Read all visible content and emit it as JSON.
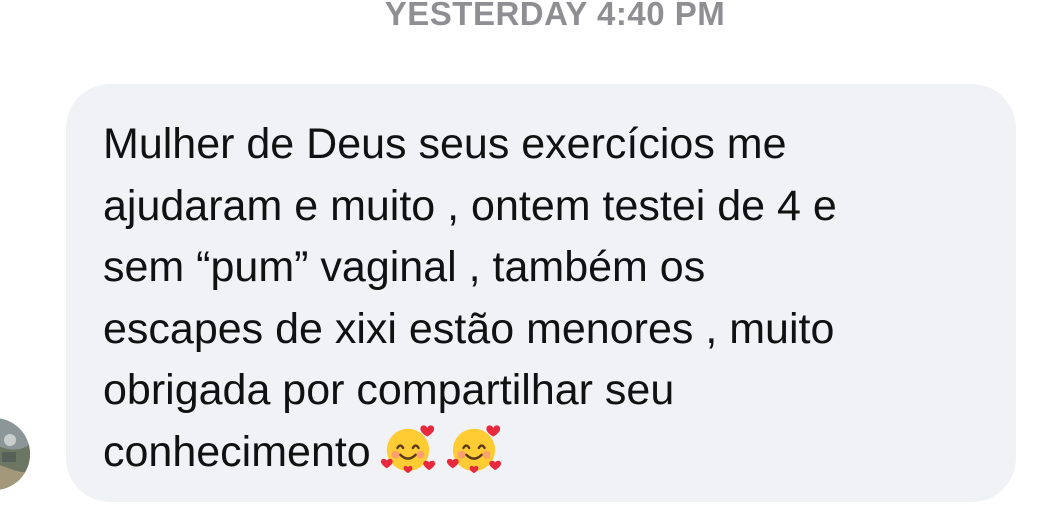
{
  "conversation": {
    "timestamp": "YESTERDAY 4:40 PM"
  },
  "message": {
    "text": "Mulher de Deus seus exercícios me\najudaram e muito , ontem testei de 4 e\nsem “pum” vaginal , também os\nescapes de xixi estão menores , muito\nobrigada por compartilhar seu\nconhecimento",
    "emojis": [
      "smiling-face-with-hearts-emoji",
      "smiling-face-with-hearts-emoji"
    ]
  },
  "sender": {
    "avatar_icon": "avatar-photo"
  },
  "colors": {
    "bubble": "#f1f2f6",
    "timestamp": "#8e8e93",
    "text": "#111111",
    "emoji_face": "#ffcc33",
    "emoji_heart": "#e8283c"
  }
}
